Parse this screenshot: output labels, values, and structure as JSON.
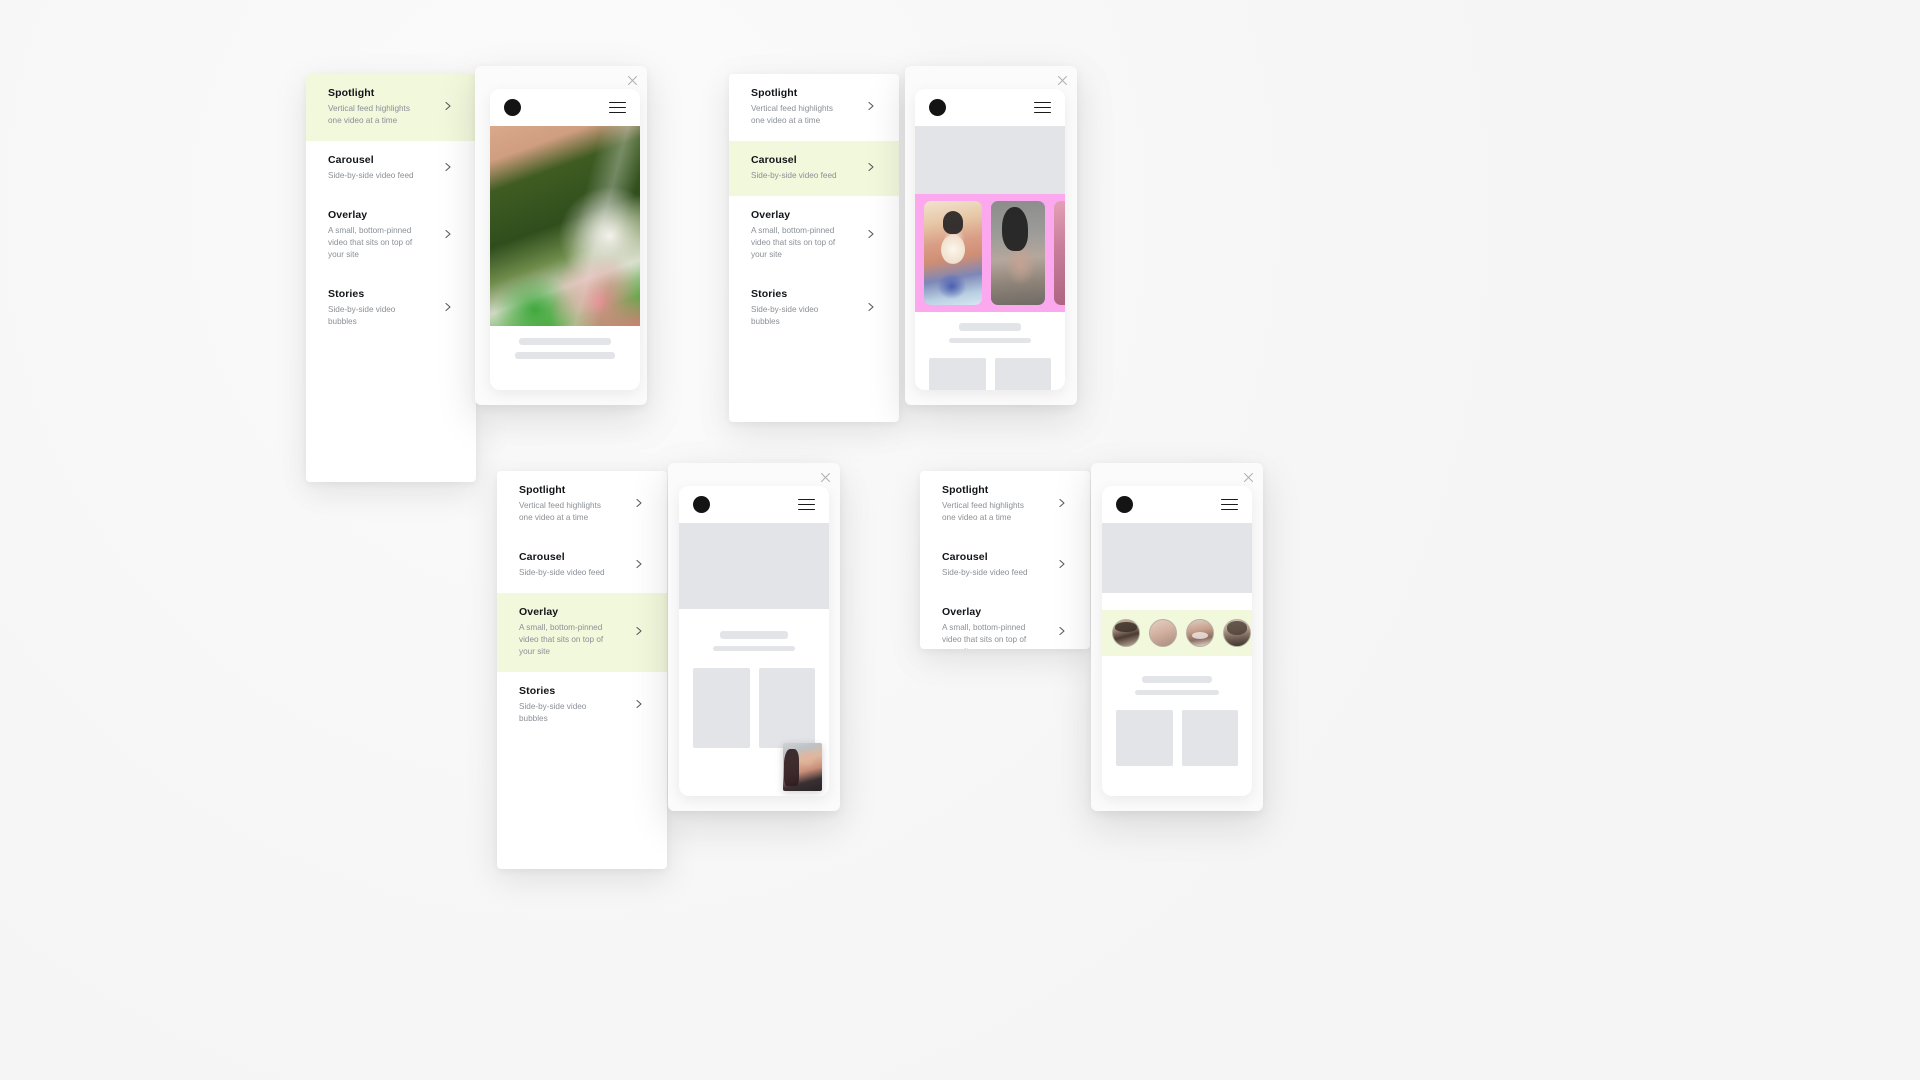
{
  "meta": {
    "background_color": "#f6f6f6",
    "highlight_color": "#f1f8dc",
    "carousel_frame_color": "#fba8ef",
    "skeleton_color": "#e2e4e7",
    "title_color": "#111418",
    "subtitle_color": "#8b9096"
  },
  "menu_items": [
    {
      "title": "Spotlight",
      "subtitle": "Vertical feed highlights one video at a time",
      "chevron": "chevron-right-icon"
    },
    {
      "title": "Carousel",
      "subtitle": "Side-by-side video feed",
      "chevron": "chevron-right-icon"
    },
    {
      "title": "Overlay",
      "subtitle": "A small, bottom-pinned video that sits on top of your site",
      "chevron": "chevron-right-icon"
    },
    {
      "title": "Stories",
      "subtitle": "Side-by-side video bubbles",
      "chevron": "chevron-right-icon"
    }
  ],
  "mockups": [
    {
      "id": "spotlight",
      "active_item": "Spotlight",
      "close_icon": "close-icon",
      "logo_icon": "brand-dot-icon",
      "menu_icon": "hamburger-menu-icon",
      "preview_type": "spotlight-video"
    },
    {
      "id": "carousel",
      "active_item": "Carousel",
      "close_icon": "close-icon",
      "logo_icon": "brand-dot-icon",
      "menu_icon": "hamburger-menu-icon",
      "preview_type": "carousel-strip"
    },
    {
      "id": "overlay",
      "active_item": "Overlay",
      "close_icon": "close-icon",
      "logo_icon": "brand-dot-icon",
      "menu_icon": "hamburger-menu-icon",
      "preview_type": "pinned-overlay-video"
    },
    {
      "id": "stories",
      "active_item": "Stories",
      "close_icon": "close-icon",
      "logo_icon": "brand-dot-icon",
      "menu_icon": "hamburger-menu-icon",
      "preview_type": "stories-bubbles"
    }
  ]
}
